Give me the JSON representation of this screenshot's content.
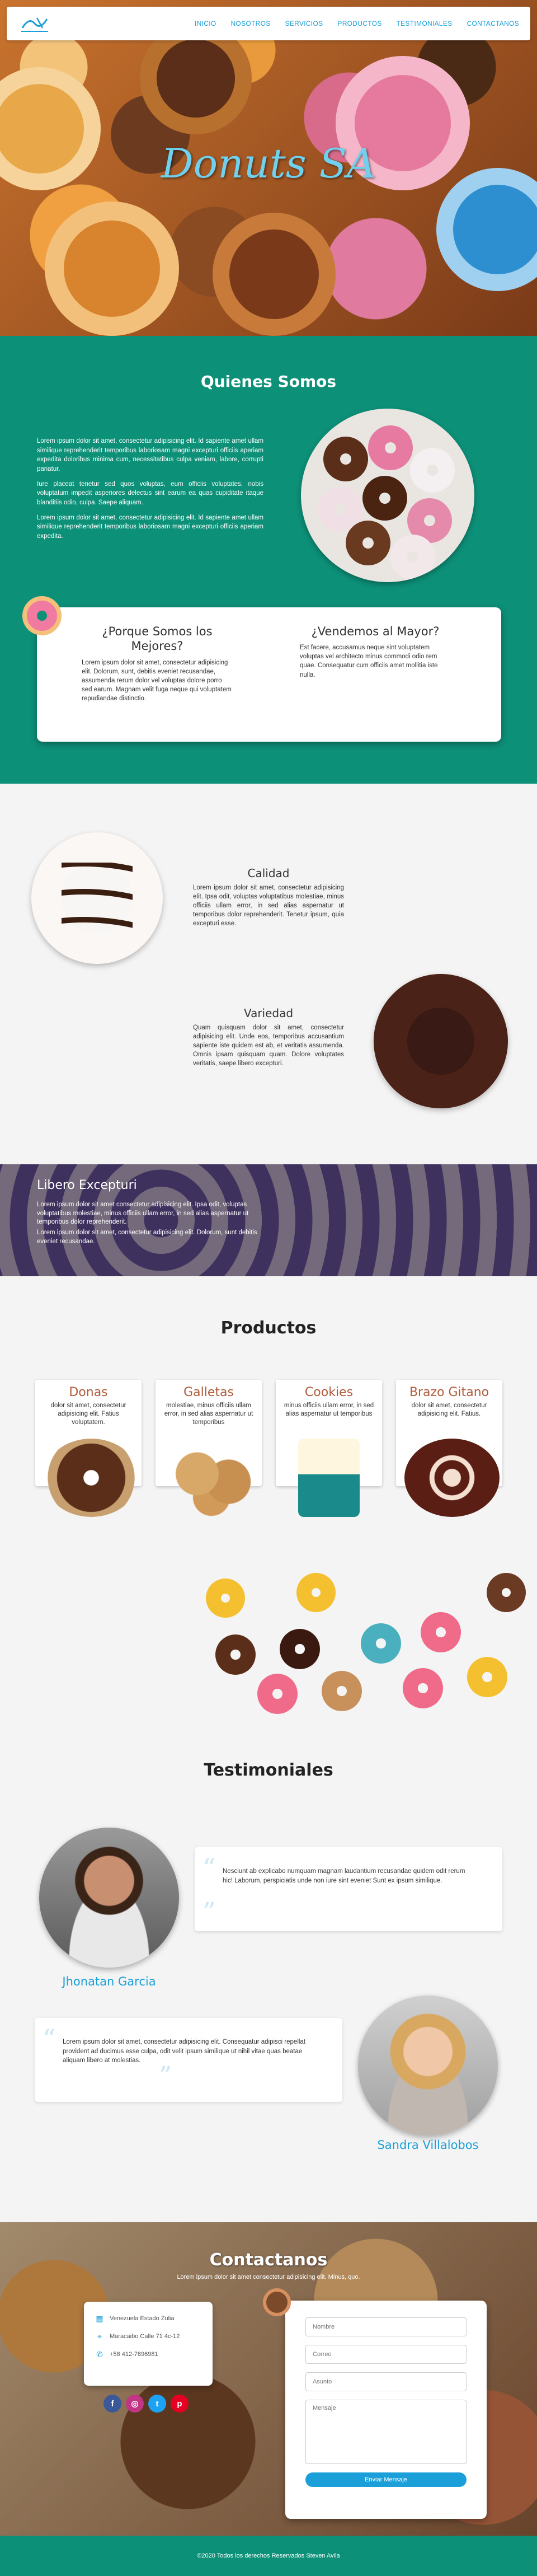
{
  "nav": {
    "items": [
      "INICIO",
      "NOSOTROS",
      "SERVICIOS",
      "PRODUCTOS",
      "TESTIMONIALES",
      "CONTACTANOS"
    ]
  },
  "hero": {
    "title": "Donuts SA"
  },
  "quienes": {
    "title": "Quienes Somos",
    "paragraphs": [
      "Lorem ipsum dolor sit amet, consectetur adipisicing elit. Id sapiente amet ullam similique reprehenderit temporibus laboriosam magni excepturi officiis aperiam expedita doloribus minima cum, necessitatibus culpa veniam, labore, corrupti pariatur.",
      "Iure placeat tenetur sed quos voluptas, eum officiis voluptates, nobis voluptatum impedit asperiores delectus sint earum ea quas cupiditate itaque blanditiis odio, culpa. Saepe aliquam.",
      "Lorem ipsum dolor sit amet, consectetur adipisicing elit. Id sapiente amet ullam similique reprehenderit temporibus laboriosam magni excepturi officiis aperiam expedita."
    ],
    "why": {
      "title": "¿Porque Somos los Mejores?",
      "text": "Lorem ipsum dolor sit amet, consectetur adipisicing elit. Dolorum, sunt, debitis eveniet recusandae, assumenda rerum dolor vel voluptas dolore porro sed earum. Magnam velit fuga neque qui voluptatem repudiandae distinctio."
    },
    "mayor": {
      "title": "¿Vendemos al Mayor?",
      "text": "Est facere, accusamus neque sint voluptatem voluptas vel architecto minus commodi odio rem quae. Consequatur cum officiis amet mollitia iste nulla."
    }
  },
  "features": {
    "calidad": {
      "title": "Calidad",
      "text": "Lorem ipsum dolor sit amet, consectetur adipisicing elit. Ipsa odit, voluptas voluptatibus molestiae, minus officiis ullam error, in sed alias aspernatur ut temporibus dolor reprehenderit. Tenetur ipsum, quia excepturi esse."
    },
    "variedad": {
      "title": "Variedad",
      "text": "Quam quisquam dolor sit amet, consectetur adipisicing elit. Unde eos, temporibus accusantium sapiente iste quidem est ab, et veritatis assumenda. Omnis ipsam quisquam quam. Dolore voluptates veritatis, saepe libero excepturi."
    }
  },
  "banner": {
    "title": "Libero Excepturi",
    "p1": "Lorem ipsum dolor sit amet consectetur adipisicing elit. Ipsa odit, voluptas voluptatibus molestiae, minus officiis ullam error, in sed alias aspernatur ut temporibus dolor reprehenderit.",
    "p2": "Lorem ipsum dolor sit amet, consectetur adipisicing elit. Dolorum, sunt debitis eveniet recusandae."
  },
  "productos": {
    "title": "Productos",
    "items": [
      {
        "name": "Donas",
        "desc": "dolor sit amet, consectetur adipisicing elit. Fatius voluptatem."
      },
      {
        "name": "Galletas",
        "desc": "molestiae, minus officiis ullam error, in sed alias aspernatur ut temporibus"
      },
      {
        "name": "Cookies",
        "desc": "minus officiis ullam error, in sed alias aspernatur ut temporibus"
      },
      {
        "name": "Brazo Gitano",
        "desc": "dolor sit amet, consectetur adipisicing elit. Fatius."
      }
    ]
  },
  "testimoniales": {
    "title": "Testimoniales",
    "items": [
      {
        "name": "Jhonatan Garcia",
        "quote": "Nesciunt ab explicabo numquam magnam laudantium recusandae quidem odit rerum hic! Laborum, perspiciatis unde non iure sint eveniet Sunt ex ipsum similique."
      },
      {
        "name": "Sandra Villalobos",
        "quote": "Lorem ipsum dolor sit amet, consectetur adipisicing elit. Consequatur adipisci repellat provident ad ducimus esse culpa, odit velit ipsum similique ut nihil vitae quas beatae aliquam libero at molestias."
      }
    ]
  },
  "contacto": {
    "title": "Contactanos",
    "subtitle": "Lorem ipsum dolor sit amet consectetur adipisicing elit. Minus, quo.",
    "address1": "Venezuela Estado Zulia",
    "address2": "Maracaibo Calle 71 4c-12",
    "phone": "+58 412-7896981",
    "form": {
      "name_placeholder": "Nombre",
      "email_placeholder": "Correo",
      "subject_placeholder": "Asunto",
      "message_placeholder": "Mensaje",
      "submit_label": "Enviar Mensaje"
    }
  },
  "footer": {
    "text": "©2020 Todos los derechos Reservados Steven Avila"
  },
  "colors": {
    "teal": "#0d9078",
    "accent": "#1a9fd8",
    "brown": "#b05a3a"
  }
}
